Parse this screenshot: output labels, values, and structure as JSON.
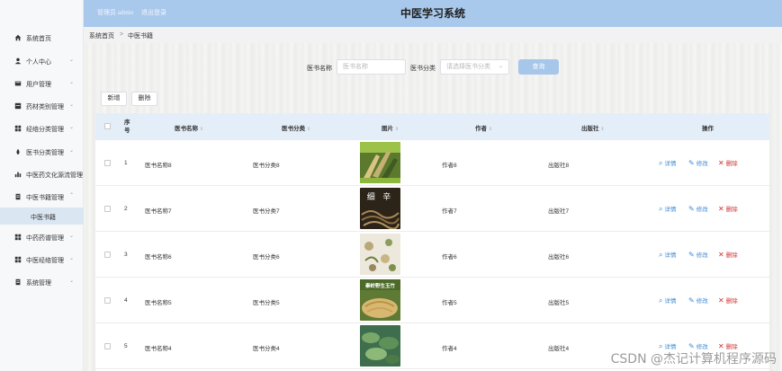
{
  "header": {
    "user_label": "管理员 admin",
    "logout_label": "退出登录",
    "app_title": "中医学习系统"
  },
  "sidebar": {
    "items": [
      {
        "label": "系统首页",
        "icon": "home-icon",
        "expand": ""
      },
      {
        "label": "个人中心",
        "icon": "user-icon",
        "expand": "⌄"
      },
      {
        "label": "用户管理",
        "icon": "users-icon",
        "expand": "⌄"
      },
      {
        "label": "药材类别管理",
        "icon": "box-icon",
        "expand": "⌄"
      },
      {
        "label": "经络分类管理",
        "icon": "grid-icon",
        "expand": "⌄"
      },
      {
        "label": "医书分类管理",
        "icon": "drop-icon",
        "expand": "⌄"
      },
      {
        "label": "中医药文化源流管理",
        "icon": "chart-icon",
        "expand": ""
      },
      {
        "label": "中医书籍管理",
        "icon": "book-icon",
        "expand": "⌃"
      },
      {
        "label": "中药药谱管理",
        "icon": "grid-icon",
        "expand": "⌄"
      },
      {
        "label": "中医经络管理",
        "icon": "grid-icon",
        "expand": "⌄"
      },
      {
        "label": "系统管理",
        "icon": "book-icon",
        "expand": "⌄"
      }
    ],
    "sub_item": "中医书籍"
  },
  "breadcrumb": {
    "home": "系统首页",
    "sep": ">",
    "current": "中医书籍"
  },
  "search": {
    "name_label": "医书名称",
    "name_placeholder": "医书名称",
    "category_label": "医书分类",
    "category_placeholder": "请选择医书分类",
    "query_button": "查询"
  },
  "toolbar": {
    "add_button": "新增",
    "delete_button": "删除"
  },
  "table": {
    "headers": {
      "index": "序号",
      "name": "医书名称",
      "category": "医书分类",
      "image": "图片",
      "author": "作者",
      "publisher": "出版社",
      "actions": "操作"
    },
    "sort_glyph": "⇕",
    "rows": [
      {
        "index": "1",
        "name": "医书名称8",
        "category": "医书分类8",
        "author": "作者8",
        "publisher": "出版社8"
      },
      {
        "index": "2",
        "name": "医书名称7",
        "category": "医书分类7",
        "author": "作者7",
        "publisher": "出版社7",
        "image_text": "细 辛"
      },
      {
        "index": "3",
        "name": "医书名称6",
        "category": "医书分类6",
        "author": "作者6",
        "publisher": "出版社6"
      },
      {
        "index": "4",
        "name": "医书名称5",
        "category": "医书分类5",
        "author": "作者5",
        "publisher": "出版社5",
        "image_text": "秦岭野生玉竹"
      },
      {
        "index": "5",
        "name": "医书名称4",
        "category": "医书分类4",
        "author": "作者4",
        "publisher": "出版社4"
      }
    ],
    "actions": {
      "detail": "详情",
      "edit": "修改",
      "delete": "删除"
    }
  },
  "watermark": "CSDN @杰记计算机程序源码",
  "colors": {
    "header_bg": "#a8c8ec",
    "query_button": "#a6c6ea",
    "table_header": "#e4eef9",
    "action_link": "#3d8bd4",
    "delete_link": "#d03030",
    "active_sub_bg": "#dbe6f3"
  }
}
